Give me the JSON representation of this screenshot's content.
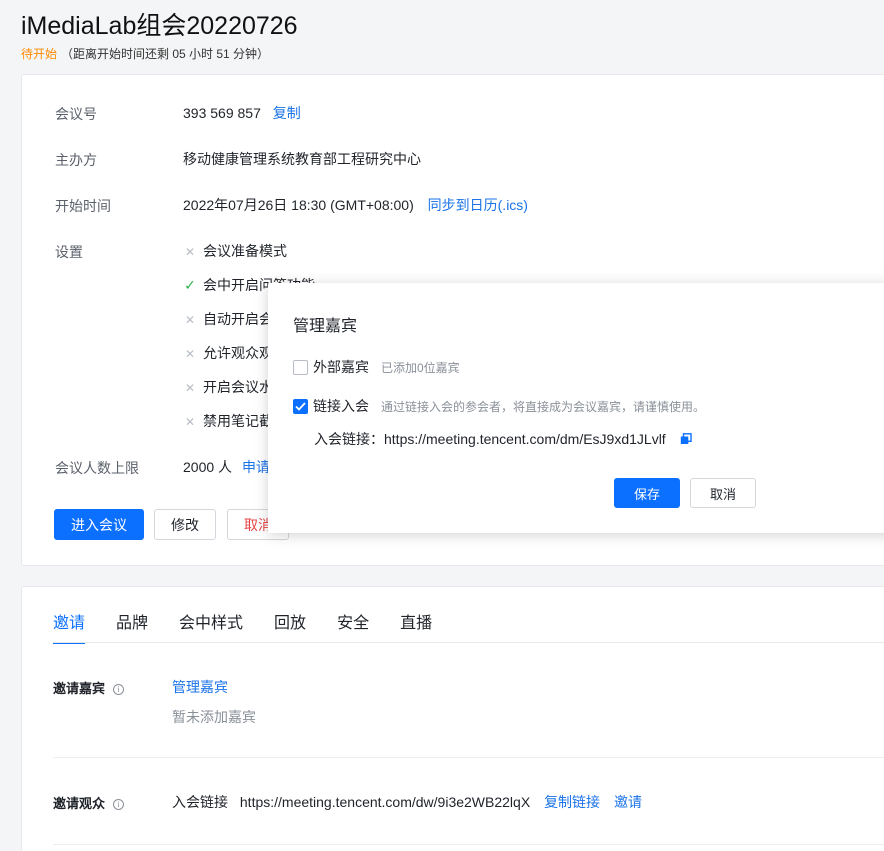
{
  "header": {
    "title": "iMediaLab组会20220726",
    "status": "待开始",
    "countdown": "（距离开始时间还剩 05 小时 51 分钟）"
  },
  "details": {
    "meeting_id_label": "会议号",
    "meeting_id": "393 569 857",
    "copy_label": "复制",
    "host_label": "主办方",
    "host": "移动健康管理系统教育部工程研究中心",
    "start_label": "开始时间",
    "start_time": "2022年07月26日 18:30 (GMT+08:00)",
    "sync_label": "同步到日历(.ics)",
    "settings_label": "设置",
    "settings": [
      {
        "text": "会议准备模式",
        "enabled": false
      },
      {
        "text": "会中开启问答功能",
        "enabled": true
      },
      {
        "text": "自动开启会",
        "enabled": false
      },
      {
        "text": "允许观众观",
        "enabled": false
      },
      {
        "text": "开启会议水",
        "enabled": false
      },
      {
        "text": "禁用笔记截",
        "enabled": false
      }
    ],
    "capacity_label": "会议人数上限",
    "capacity": "2000 人",
    "apply_label": "申请"
  },
  "actions": {
    "enter": "进入会议",
    "edit": "修改",
    "cancel": "取消"
  },
  "tabs": [
    "邀请",
    "品牌",
    "会中样式",
    "回放",
    "安全",
    "直播"
  ],
  "invite": {
    "guests_label": "邀请嘉宾",
    "manage_guests": "管理嘉宾",
    "no_guests": "暂未添加嘉宾",
    "audience_label": "邀请观众",
    "join_link_label": "入会链接",
    "audience_link": "https://meeting.tencent.com/dw/9i3e2WB22lqX",
    "copy_link": "复制链接",
    "invite": "邀请"
  },
  "modal": {
    "title": "管理嘉宾",
    "external_label": "外部嘉宾",
    "external_checked": false,
    "external_hint": "已添加0位嘉宾",
    "link_join_label": "链接入会",
    "link_join_checked": true,
    "link_join_hint": "通过链接入会的参会者，将直接成为会议嘉宾，请谨慎使用。",
    "join_link_label": "入会链接：",
    "join_link": "https://meeting.tencent.com/dm/EsJ9xd1JLvlf",
    "save": "保存",
    "cancel": "取消"
  },
  "colors": {
    "accent": "#0b6fff",
    "status_pending": "#ff8a00",
    "danger": "#e54545",
    "enabled_check": "#2bb24c"
  }
}
